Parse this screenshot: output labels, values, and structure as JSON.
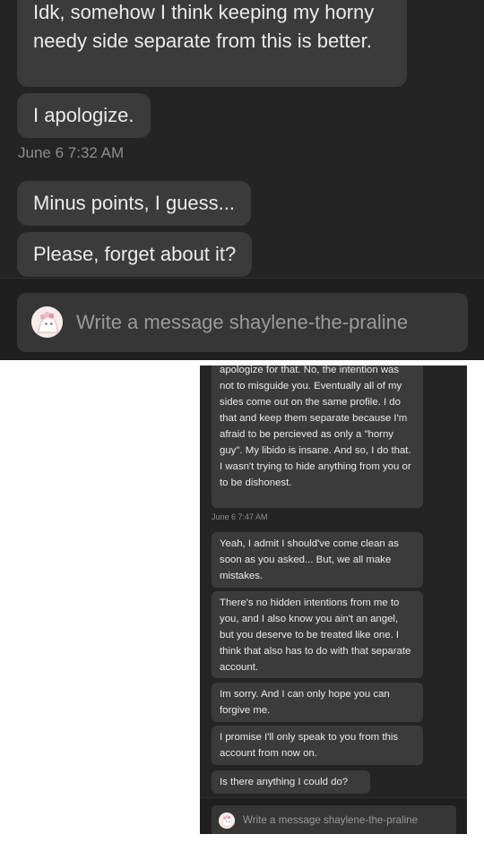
{
  "top": {
    "messages": [
      "Idk, somehow I think  keeping my horny needy side separate from this is better.",
      "I apologize.",
      "Minus points, I guess...",
      "Please, forget about it?"
    ],
    "timestamp": "June 6 7:32 AM",
    "composer": {
      "placeholder": "Write a message shaylene-the-praline",
      "avatar_icon": "pink-character-avatar-icon"
    }
  },
  "bottom": {
    "messages": [
      "apologize for that. No, the intention was not to misguide you. Eventually all of my sides come out on the same profile. I do that and keep them separate because I'm afraid to be percieved as only a \"horny guy\". My libido is insane. And so, I do that. I wasn't trying to hide anything from you or to be dishonest.",
      "Yeah, I admit I should've come clean as soon as you asked... But, we all make mistakes.",
      "There's no hidden intentions from me to you, and I also know you ain't an angel, but you deserve to be treated like one. I think that also has to do with that separate account.",
      "Im sorry. And I can only hope you can forgive me.",
      "I promise I'll only speak to you from this account from now on.",
      "Is there anything I could do?"
    ],
    "timestamp": "June 6 7:47 AM",
    "composer": {
      "placeholder": "Write a message shaylene-the-praline",
      "avatar_icon": "pink-character-avatar-icon"
    }
  },
  "colors": {
    "background": "#242424",
    "bubble": "#3b3b3b",
    "composer": "#363636",
    "text": "#ecebeb",
    "muted": "#8d8d8d"
  }
}
